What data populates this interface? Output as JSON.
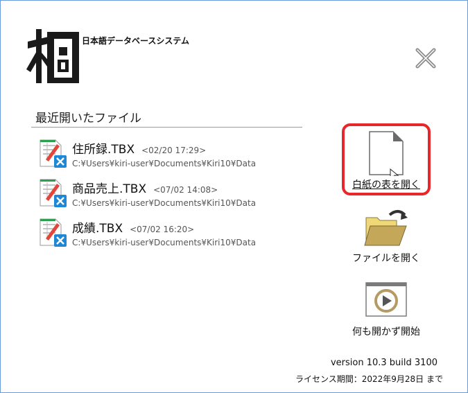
{
  "app": {
    "name": "日本語データベースシステム"
  },
  "recent": {
    "title": "最近開いたファイル",
    "files": [
      {
        "name": "住所録.TBX",
        "time": "<02/20 17:29>",
        "path": "C:¥Users¥kiri-user¥Documents¥Kiri10¥Data"
      },
      {
        "name": "商品売上.TBX",
        "time": "<07/02 14:08>",
        "path": "C:¥Users¥kiri-user¥Documents¥Kiri10¥Data"
      },
      {
        "name": "成績.TBX",
        "time": "<07/02 16:20>",
        "path": "C:¥Users¥kiri-user¥Documents¥Kiri10¥Data"
      }
    ]
  },
  "actions": {
    "new_blank": "白紙の表を開く",
    "open_file": "ファイルを開く",
    "start_empty": "何も開かず開始"
  },
  "footer": {
    "version": "version 10.3 build 3100",
    "license": "ライセンス期間：2022年9月28日 まで"
  },
  "icons": {
    "close": "close-icon",
    "logo": "kiri-logo-icon",
    "file": "tbx-file-icon",
    "new": "blank-page-icon",
    "open": "open-folder-icon",
    "start": "play-icon"
  },
  "colors": {
    "highlight": "#e8262b",
    "frame": "#6b9bd6",
    "accent_blue": "#1e88d6"
  }
}
